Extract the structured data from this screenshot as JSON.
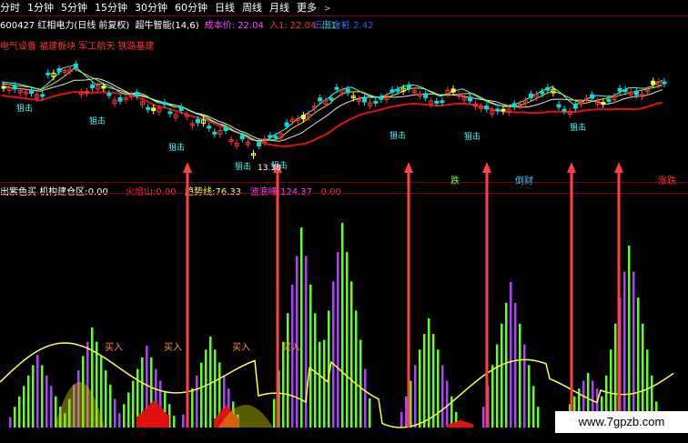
{
  "tabs": [
    "分时",
    "1分钟",
    "5分钟",
    "15分钟",
    "30分钟",
    "60分钟",
    "日线",
    "周线",
    "月线",
    "更多"
  ],
  "tabs_more_arrow": ">",
  "header1": {
    "code_name": "600427 红相电力(日线 前复权)",
    "indicator": "超牛智能(14,6)",
    "cost_label": "成本价:",
    "cost_value": "22.04",
    "in_label": "入1:",
    "in_value": "22.04",
    "out_label": "出1:",
    "out_value": "-",
    "right_label": "云天金桩",
    "right_value": "2.42"
  },
  "tags": "电气设备 福建板块 军工航天 铁路基建",
  "header2": {
    "left": "出紫色买",
    "build_label": "机构建仓区:",
    "build_value": "0.00",
    "fire_label": "火焰山:",
    "fire_value": "0.00",
    "trend_label": "趋势线:",
    "trend_value": "76.33",
    "wave_label": "波浪峰:",
    "wave_value": "124.37",
    "extra_value": "0.00"
  },
  "markers": {
    "sniper": "狙击",
    "sniper_low": "13.38",
    "chase": "跌",
    "trap": "倒财",
    "rise": "涨跌"
  },
  "buy_label": "买入",
  "watermark": "www.7gpzb.com",
  "colors": {
    "up": "#ff3030",
    "down": "#00e0e0",
    "ma_red": "#e01010",
    "ma_white": "#e0e0e0",
    "ma_yellow": "#e8e000",
    "purple": "#b040ff",
    "green": "#60ff20",
    "trend_line": "#ffff40",
    "arrow": "#ff4040"
  },
  "chart_data": {
    "type": "bar",
    "title": "",
    "xlabel": "",
    "ylabel": "",
    "series": [
      {
        "name": "趋势线",
        "values": []
      },
      {
        "name": "波浪峰",
        "values": []
      }
    ]
  }
}
